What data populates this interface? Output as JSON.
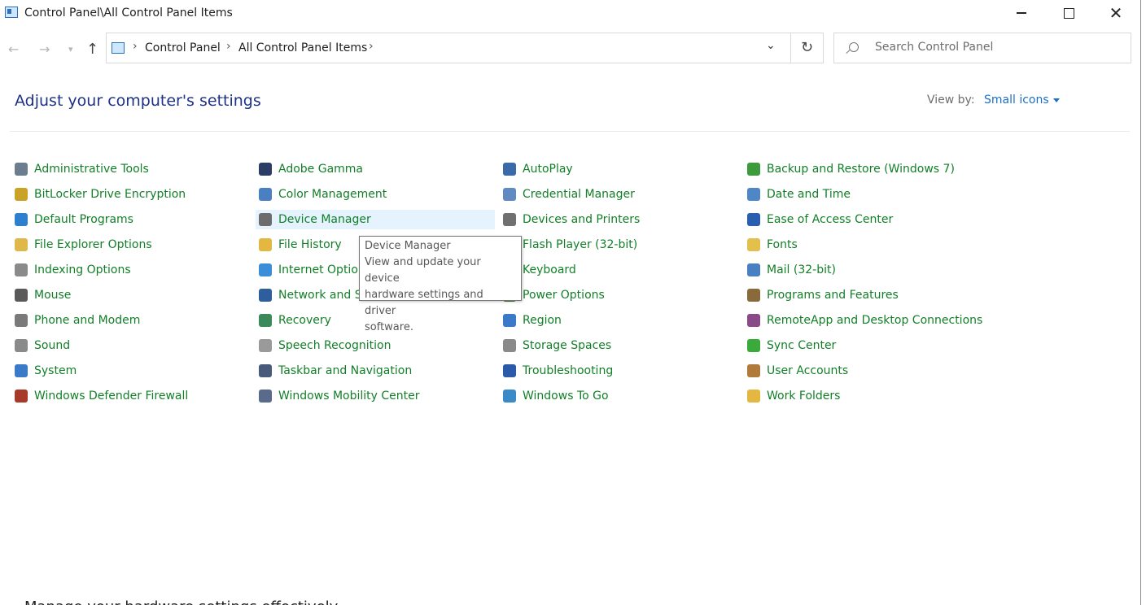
{
  "window": {
    "title": "Control Panel\\All Control Panel Items"
  },
  "address": {
    "crumbs": [
      "Control Panel",
      "All Control Panel Items"
    ]
  },
  "search": {
    "placeholder": "Search Control Panel"
  },
  "header": {
    "title": "Adjust your computer's settings",
    "view_by_label": "View by:",
    "view_by_value": "Small icons"
  },
  "items": [
    {
      "label": "Administrative Tools",
      "icon": "admin-tools-icon",
      "color": "#6b7d8f"
    },
    {
      "label": "Adobe Gamma",
      "icon": "monitor-icon",
      "color": "#2c3e66"
    },
    {
      "label": "AutoPlay",
      "icon": "autoplay-icon",
      "color": "#3b6aa8"
    },
    {
      "label": "Backup and Restore (Windows 7)",
      "icon": "backup-icon",
      "color": "#3d9a3d"
    },
    {
      "label": "BitLocker Drive Encryption",
      "icon": "key-icon",
      "color": "#c9a227"
    },
    {
      "label": "Color Management",
      "icon": "color-icon",
      "color": "#4a7fc1"
    },
    {
      "label": "Credential Manager",
      "icon": "credential-icon",
      "color": "#5f8bc2"
    },
    {
      "label": "Date and Time",
      "icon": "clock-icon",
      "color": "#4f86c6"
    },
    {
      "label": "Default Programs",
      "icon": "default-programs-icon",
      "color": "#2f7fcf"
    },
    {
      "label": "Device Manager",
      "icon": "device-manager-icon",
      "color": "#6c6c6c"
    },
    {
      "label": "Devices and Printers",
      "icon": "printer-icon",
      "color": "#707070"
    },
    {
      "label": "Ease of Access Center",
      "icon": "ease-of-access-icon",
      "color": "#2a5fb0"
    },
    {
      "label": "File Explorer Options",
      "icon": "folder-options-icon",
      "color": "#e0b84a"
    },
    {
      "label": "File History",
      "icon": "file-history-icon",
      "color": "#e3b740"
    },
    {
      "label": "Flash Player (32-bit)",
      "icon": "flash-icon",
      "color": "#b03030"
    },
    {
      "label": "Fonts",
      "icon": "fonts-icon",
      "color": "#e3c04c"
    },
    {
      "label": "Indexing Options",
      "icon": "indexing-icon",
      "color": "#8a8a8a"
    },
    {
      "label": "Internet Options",
      "icon": "internet-icon",
      "color": "#3a8fd8"
    },
    {
      "label": "Keyboard",
      "icon": "keyboard-icon",
      "color": "#7a7a7a"
    },
    {
      "label": "Mail (32-bit)",
      "icon": "mail-icon",
      "color": "#4a7fc1"
    },
    {
      "label": "Mouse",
      "icon": "mouse-icon",
      "color": "#5a5a5a"
    },
    {
      "label": "Network and Sharing Center",
      "icon": "network-icon",
      "color": "#2e5e9e"
    },
    {
      "label": "Power Options",
      "icon": "power-icon",
      "color": "#4a7a3a"
    },
    {
      "label": "Programs and Features",
      "icon": "programs-icon",
      "color": "#8a6a3a"
    },
    {
      "label": "Phone and Modem",
      "icon": "phone-icon",
      "color": "#7a7a7a"
    },
    {
      "label": "Recovery",
      "icon": "recovery-icon",
      "color": "#3a8a5a"
    },
    {
      "label": "Region",
      "icon": "region-icon",
      "color": "#3a7ac8"
    },
    {
      "label": "RemoteApp and Desktop Connections",
      "icon": "remoteapp-icon",
      "color": "#8a4a8a"
    },
    {
      "label": "Sound",
      "icon": "speaker-icon",
      "color": "#8a8a8a"
    },
    {
      "label": "Speech Recognition",
      "icon": "microphone-icon",
      "color": "#9a9a9a"
    },
    {
      "label": "Storage Spaces",
      "icon": "storage-icon",
      "color": "#8a8a8a"
    },
    {
      "label": "Sync Center",
      "icon": "sync-icon",
      "color": "#3aaa3a"
    },
    {
      "label": "System",
      "icon": "system-icon",
      "color": "#3a7ac8"
    },
    {
      "label": "Taskbar and Navigation",
      "icon": "taskbar-icon",
      "color": "#4a5a7a"
    },
    {
      "label": "Troubleshooting",
      "icon": "troubleshoot-icon",
      "color": "#2a5aa8"
    },
    {
      "label": "User Accounts",
      "icon": "user-accounts-icon",
      "color": "#b07a3a"
    },
    {
      "label": "Windows Defender Firewall",
      "icon": "firewall-icon",
      "color": "#a83a2a"
    },
    {
      "label": "Windows Mobility Center",
      "icon": "mobility-icon",
      "color": "#5a6a8a"
    },
    {
      "label": "Windows To Go",
      "icon": "windows-to-go-icon",
      "color": "#3a8ac8"
    },
    {
      "label": "Work Folders",
      "icon": "work-folders-icon",
      "color": "#e3b740"
    }
  ],
  "tooltip": {
    "title": "Device Manager",
    "lines": [
      "View and update your device",
      "hardware settings and driver",
      "software."
    ]
  },
  "background_text": "Manage your hardware settings effectively"
}
